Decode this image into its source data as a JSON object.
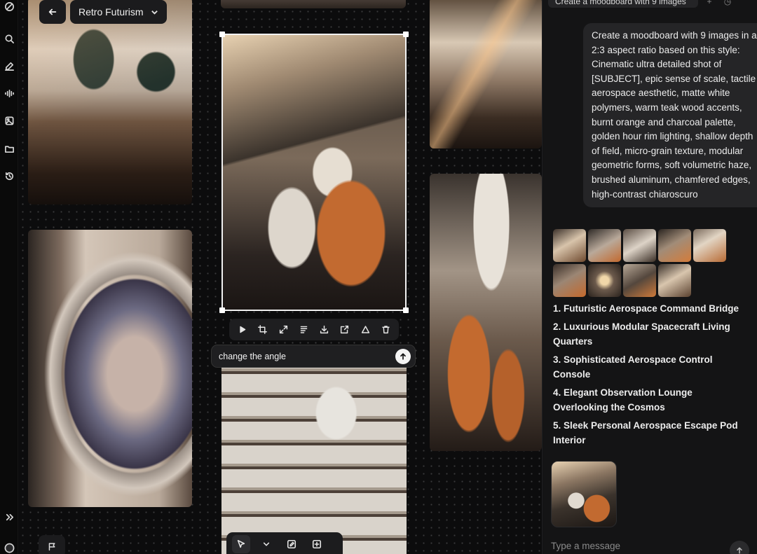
{
  "header": {
    "board_name": "Retro Futurism"
  },
  "rail": {
    "icons": [
      "logo-icon",
      "search-icon",
      "edit-icon",
      "audio-wave-icon",
      "gallery-icon",
      "folder-icon",
      "history-icon",
      "expand-icon",
      "avatar"
    ]
  },
  "canvas": {
    "image_toolbar": [
      "play-icon",
      "crop-icon",
      "expand-icon",
      "align-icon",
      "download-icon",
      "share-icon",
      "adjust-icon",
      "delete-icon"
    ],
    "prompt": {
      "value": "change the angle"
    },
    "bottom_tools": [
      "select-tool-icon",
      "chevron-down-icon",
      "edit-image-icon",
      "add-image-icon"
    ]
  },
  "chat": {
    "top_pill": "Create a moodboard with 9 images",
    "user_message": "Create a moodboard with 9 images in a 2:3 aspect ratio based on this style: Cinematic ultra detailed shot of [SUBJECT], epic sense of scale, tactile aerospace aesthetic, matte white polymers, warm teak wood accents, burnt orange and charcoal palette, golden hour rim lighting, shallow depth of field, micro-grain texture, modular geometric forms, soft volumetric haze, brushed aluminum, chamfered edges, high-contrast chiaroscuro",
    "thumbnail_count": 9,
    "results": [
      "1. Futuristic Aerospace Command Bridge",
      "2. Luxurious Modular Spacecraft Living Quarters",
      "3. Sophisticated Aerospace Control Console",
      "4. Elegant Observation Lounge Overlooking the Cosmos",
      "5. Sleek Personal Aerospace Escape Pod Interior"
    ],
    "input_placeholder": "Type a message"
  },
  "colors": {
    "background": "#0b0b0c",
    "panel": "#141415",
    "accent_orange": "#c26a30"
  }
}
